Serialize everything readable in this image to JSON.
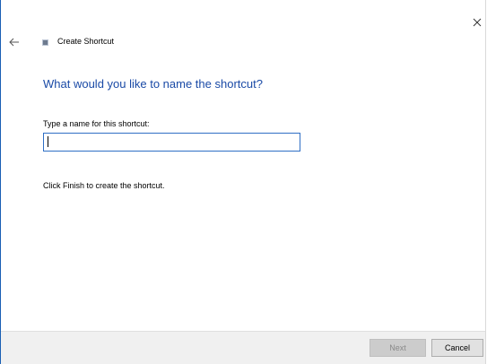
{
  "window": {
    "title": "Create Shortcut",
    "close_icon": "close-icon",
    "back_icon": "back-arrow-icon",
    "app_icon": "shortcut-app-icon"
  },
  "main": {
    "heading": "What would you like to name the shortcut?",
    "name_label": "Type a name for this shortcut:",
    "name_value": "",
    "hint": "Click Finish to create the shortcut."
  },
  "footer": {
    "next_label": "Next",
    "cancel_label": "Cancel",
    "next_enabled": false
  },
  "colors": {
    "heading": "#1a4aa6",
    "input_border": "#2f6fc5",
    "window_left_border": "#1a5fb4",
    "footer_bg": "#f0f0f0"
  }
}
